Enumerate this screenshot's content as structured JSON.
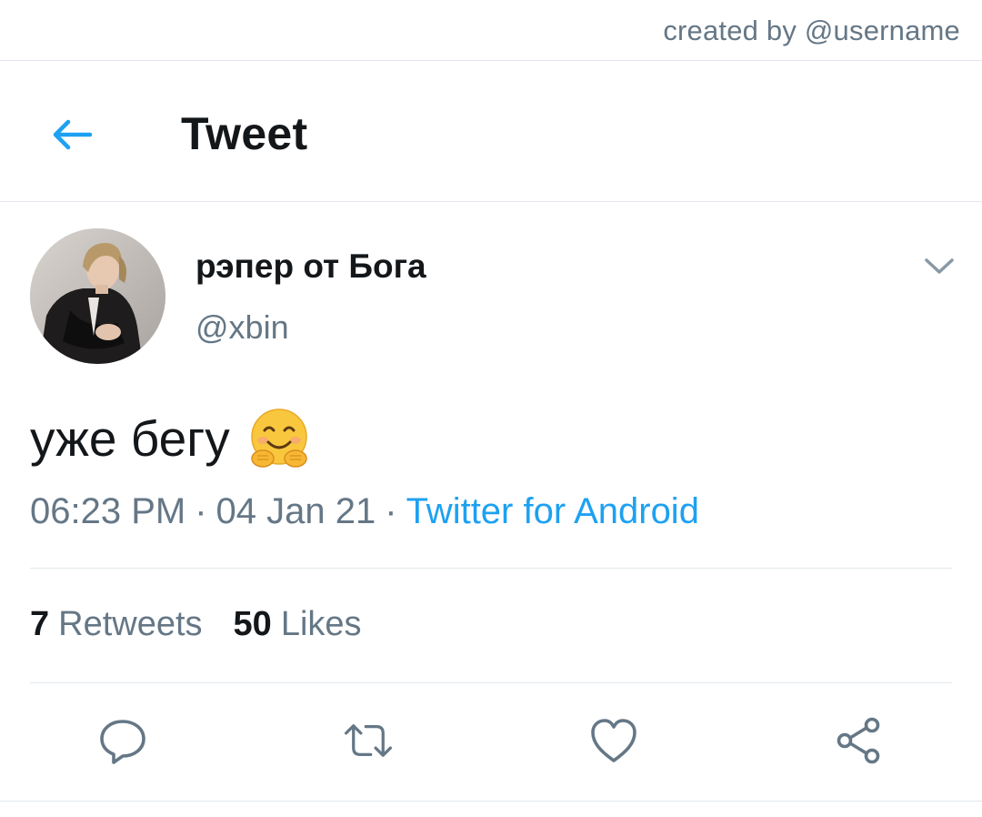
{
  "credit": "created by @username",
  "header": {
    "title": "Tweet",
    "back_icon": "arrow-left-icon",
    "accent": "#1da1f2"
  },
  "tweet": {
    "display_name": "рэпер от Бога",
    "handle": "@xbin",
    "text": "уже бегу",
    "emoji": "hugging-face-emoji",
    "time": "06:23 PM",
    "date": "04 Jan 21",
    "separator": "·",
    "source": "Twitter for Android"
  },
  "stats": {
    "retweets_count": "7",
    "retweets_label": "Retweets",
    "likes_count": "50",
    "likes_label": "Likes"
  },
  "actions": [
    {
      "name": "reply",
      "icon": "reply-bubble-icon"
    },
    {
      "name": "retweet",
      "icon": "retweet-icon"
    },
    {
      "name": "like",
      "icon": "heart-icon"
    },
    {
      "name": "share",
      "icon": "share-icon"
    }
  ],
  "colors": {
    "primary_text": "#14171a",
    "secondary_text": "#657786",
    "link": "#1da1f2",
    "divider": "#e1e8ed"
  }
}
